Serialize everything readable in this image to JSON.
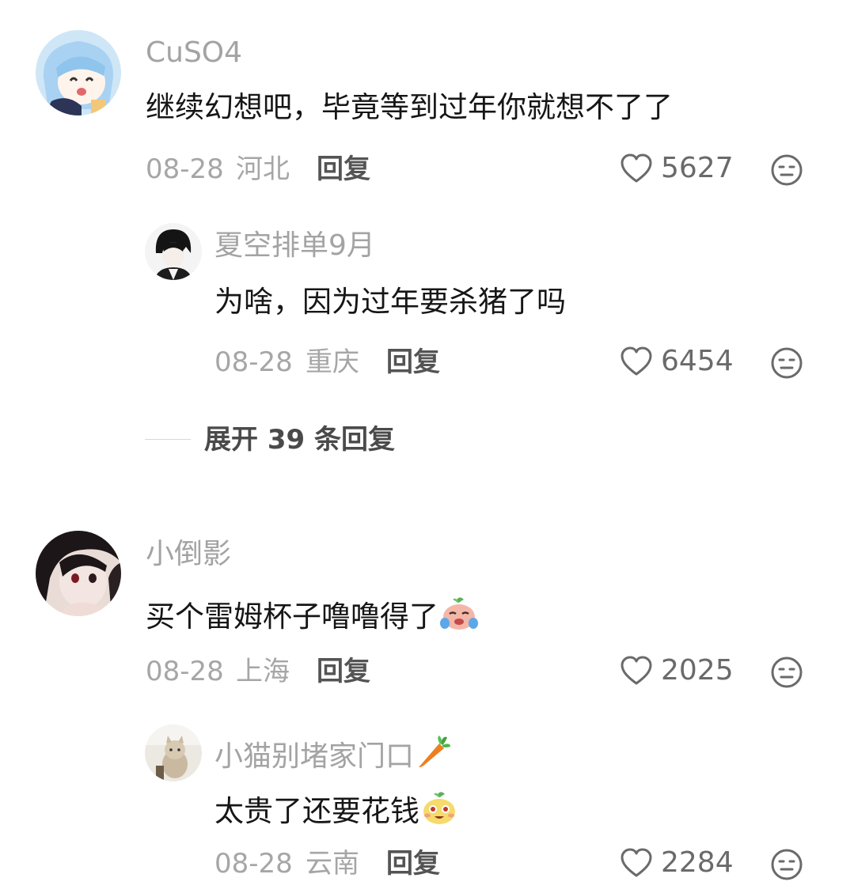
{
  "comments": [
    {
      "username": "CuSO4",
      "content": "继续幻想吧，毕竟等到过年你就想不了了",
      "date": "08-28",
      "location": "河北",
      "reply_label": "回复",
      "likes": "5627",
      "replies": [
        {
          "username": "夏空排单9月",
          "content": "为啥，因为过年要杀猪了吗",
          "date": "08-28",
          "location": "重庆",
          "reply_label": "回复",
          "likes": "6454"
        }
      ],
      "expand_label": "展开 39 条回复"
    },
    {
      "username": "小倒影",
      "content": "买个雷姆杯子噜噜得了",
      "content_emoji": "crying-emoji",
      "date": "08-28",
      "location": "上海",
      "reply_label": "回复",
      "likes": "2025",
      "replies": [
        {
          "username": "小猫别堵家门口",
          "username_emoji": "carrot-emoji",
          "content": "太贵了还要花钱",
          "content_emoji": "grinning-emoji",
          "date": "08-28",
          "location": "云南",
          "reply_label": "回复",
          "likes": "2284"
        }
      ]
    }
  ],
  "colors": {
    "username": "#a3a3a3",
    "content": "#161616",
    "meta": "#a6a6a6",
    "reply": "#545454",
    "icon": "#6a6a6a"
  }
}
